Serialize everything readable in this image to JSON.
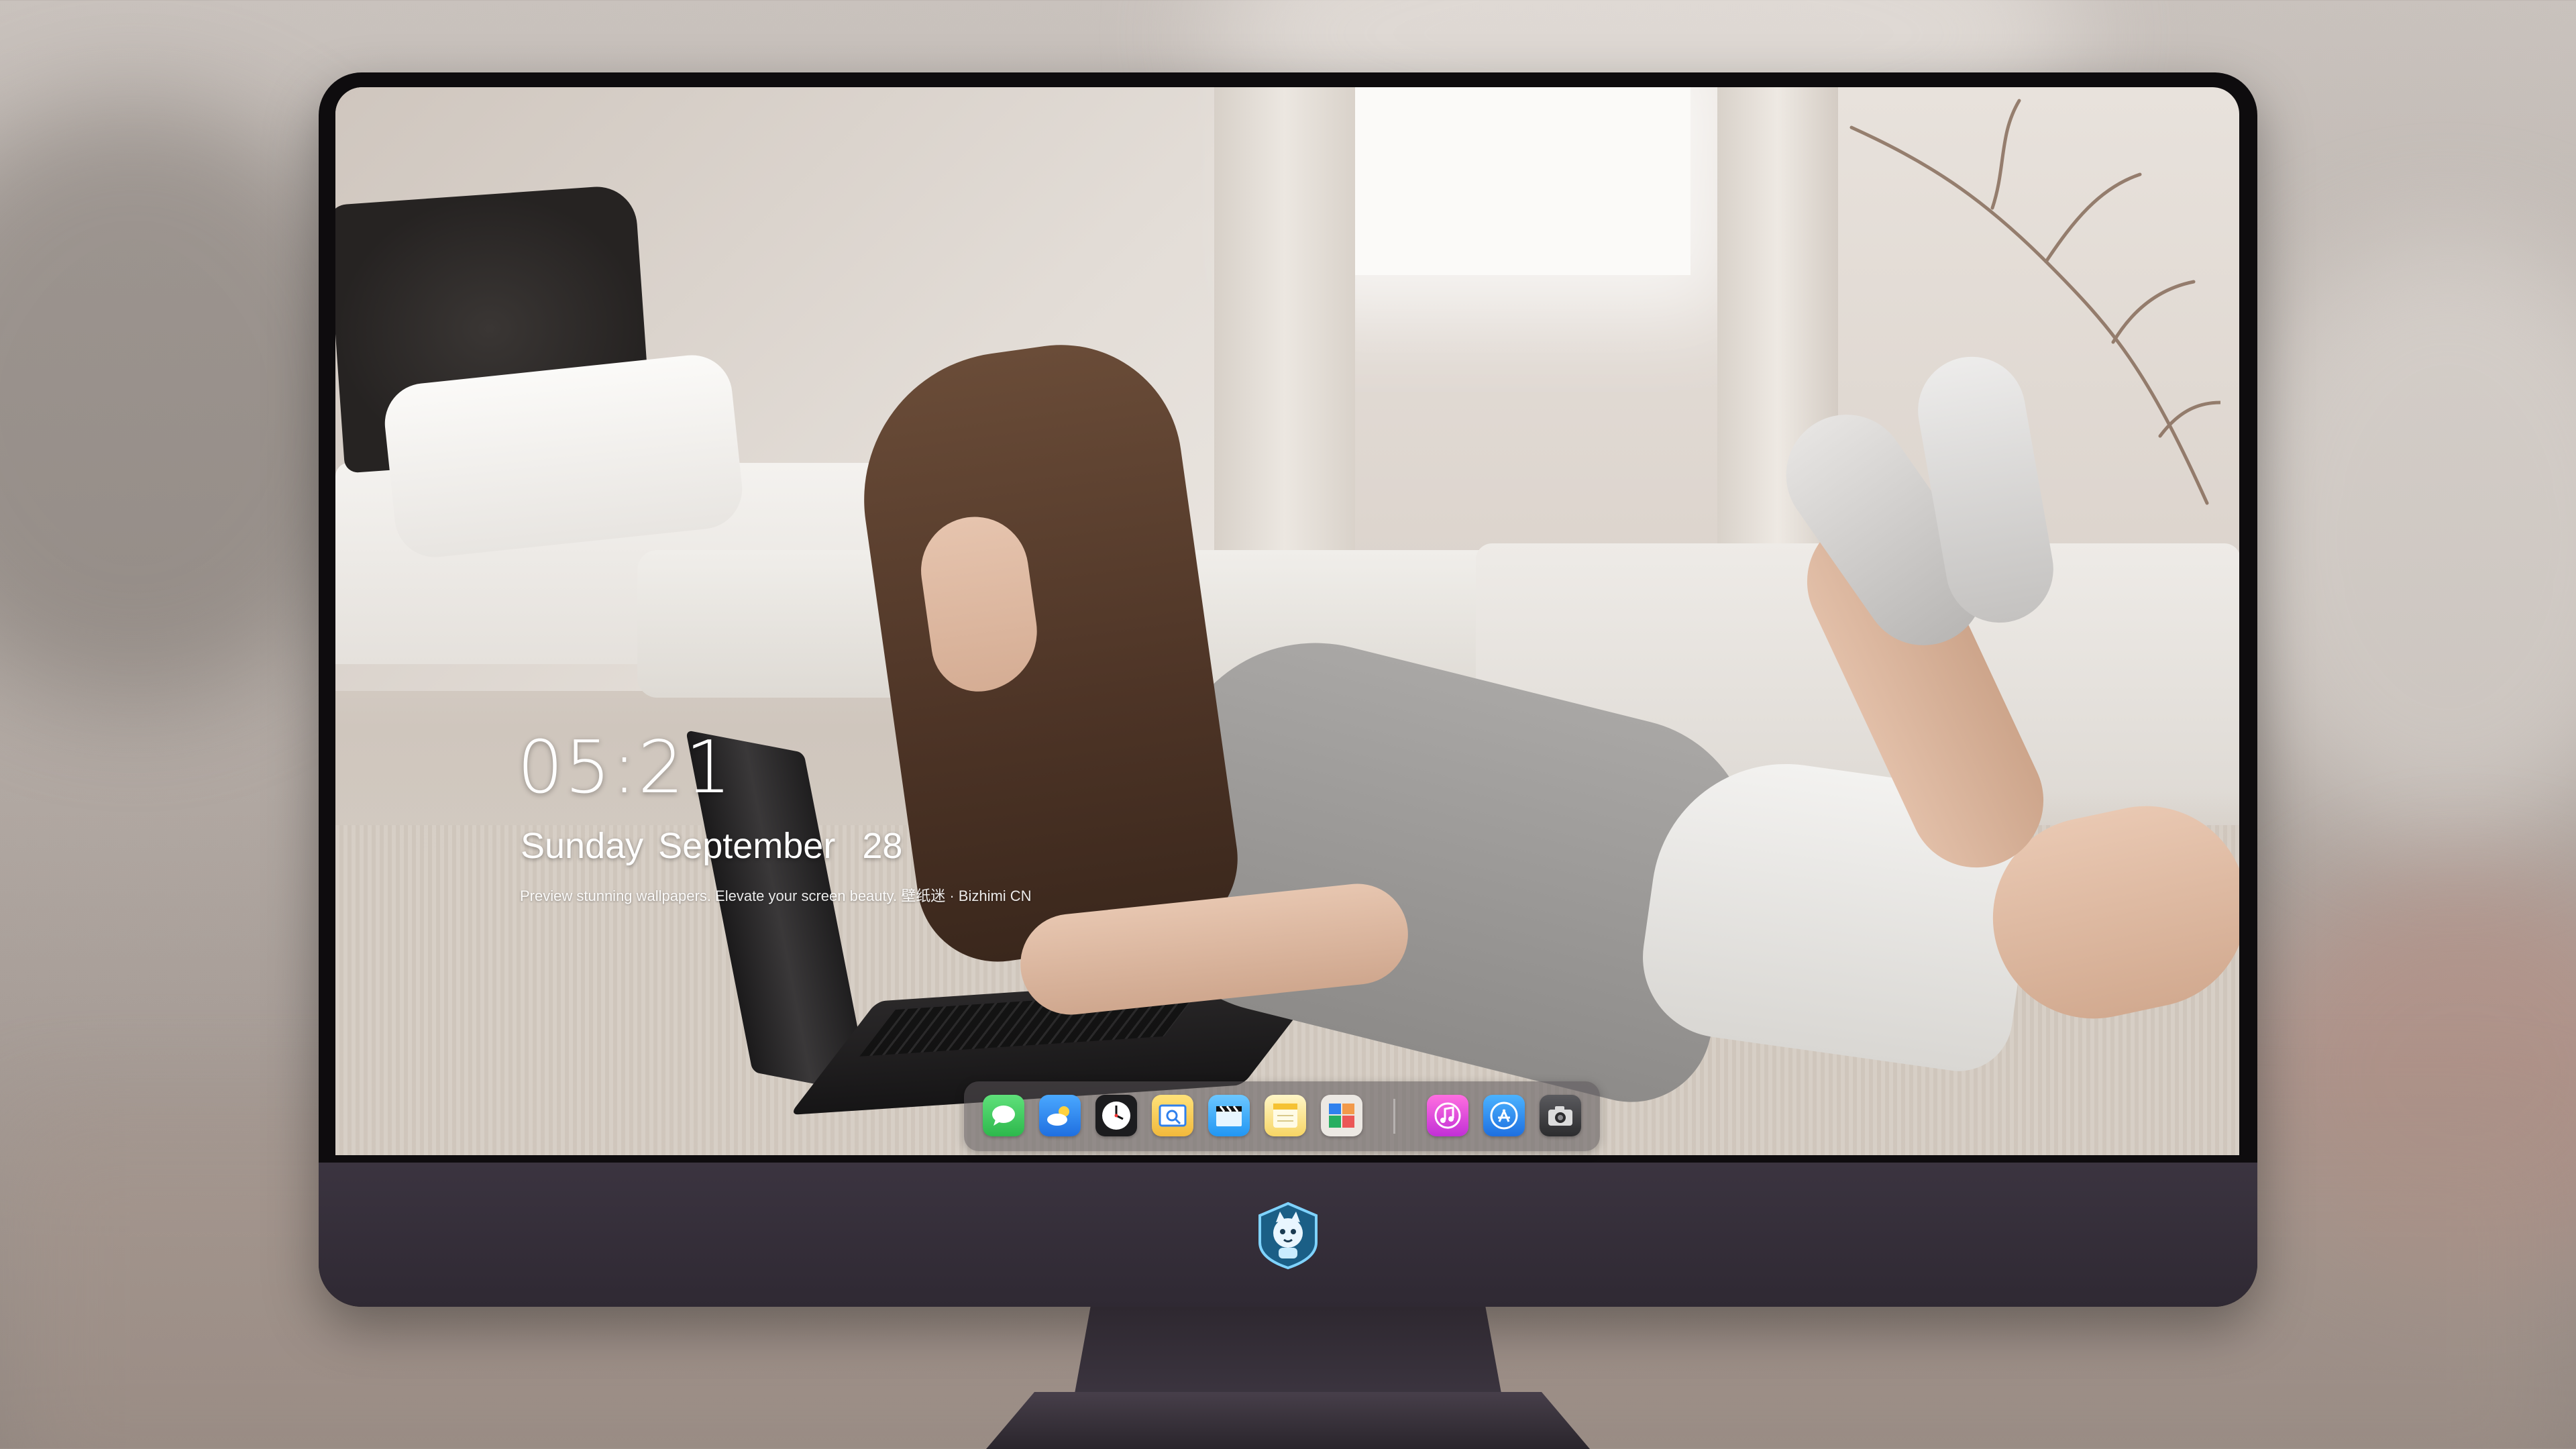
{
  "lock_screen": {
    "time": "05:21",
    "weekday": "Sunday",
    "month": "September",
    "day": "28",
    "tagline": "Preview stunning wallpapers. Elevate your screen beauty. 壁纸迷 · Bizhimi CN"
  },
  "dock": {
    "apps": [
      {
        "name": "messages",
        "icon": "speech-bubble-icon",
        "color": "#34c759"
      },
      {
        "name": "weather",
        "icon": "cloud-sun-icon",
        "color": "#2d8cf0"
      },
      {
        "name": "clock",
        "icon": "clock-icon",
        "color": "#1c1c1e"
      },
      {
        "name": "preview",
        "icon": "photo-viewer-icon",
        "color": "#f2c94c"
      },
      {
        "name": "clips",
        "icon": "clapperboard-icon",
        "color": "#3fa9f5"
      },
      {
        "name": "notes",
        "icon": "notes-icon",
        "color": "#f7d564"
      },
      {
        "name": "photo-booth",
        "icon": "photos-grid-icon",
        "color": "#e9e5e0"
      },
      {
        "name": "music",
        "icon": "music-note-icon",
        "color": "#e04bd6"
      },
      {
        "name": "app-store",
        "icon": "app-store-icon",
        "color": "#1e90ff"
      },
      {
        "name": "camera",
        "icon": "camera-icon",
        "color": "#3a3a3c"
      }
    ]
  },
  "hardware": {
    "chin_logo": "mascot-logo-icon"
  }
}
